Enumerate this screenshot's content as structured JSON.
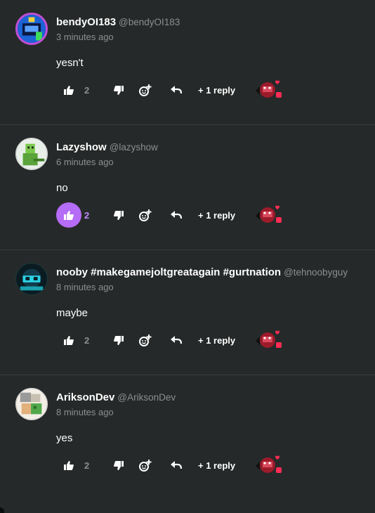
{
  "comments": [
    {
      "display_name": "bendyOI183",
      "handle": "@bendyOI183",
      "time": "3 minutes ago",
      "text": "yesn't",
      "likes": "2",
      "liked": false,
      "replies": "+ 1 reply"
    },
    {
      "display_name": "Lazyshow",
      "handle": "@lazyshow",
      "time": "6 minutes ago",
      "text": "no",
      "likes": "2",
      "liked": true,
      "replies": "+ 1 reply"
    },
    {
      "display_name": "nooby #makegamejoltgreatagain #gurtnation",
      "handle": "@tehnoobyguy",
      "time": "8 minutes ago",
      "text": "maybe",
      "likes": "2",
      "liked": false,
      "replies": "+ 1 reply"
    },
    {
      "display_name": "AriksonDev",
      "handle": "@AriksonDev",
      "time": "8 minutes ago",
      "text": "yes",
      "likes": "2",
      "liked": false,
      "replies": "+ 1 reply"
    }
  ],
  "icons": {
    "like": "thumbs-up-icon",
    "dislike": "thumbs-down-icon",
    "react": "add-reaction-icon",
    "reply": "reply-arrow-icon"
  },
  "colors": {
    "background": "#262929",
    "accent": "#b56cf6",
    "muted": "#8b8f8f"
  }
}
